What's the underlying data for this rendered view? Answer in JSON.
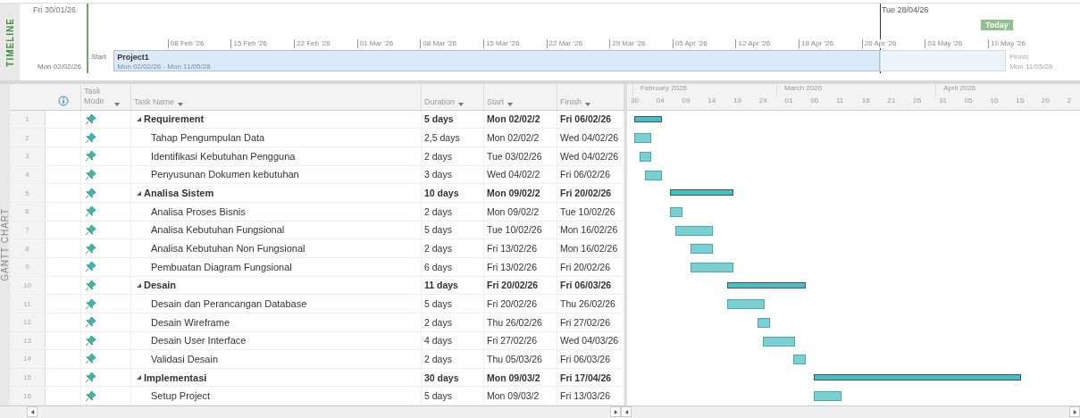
{
  "timeline": {
    "side_label": "TIMELINE",
    "left_date": "Fri 30/01/26",
    "today_date": "Tue 28/04/26",
    "today_badge": "Today",
    "ticks": [
      "08 Feb '26",
      "15 Feb '26",
      "22 Feb '26",
      "01 Mar '26",
      "08 Mar '26",
      "15 Mar '26",
      "22 Mar '26",
      "29 Mar '26",
      "05 Apr '26",
      "12 Apr '26",
      "19 Apr '26",
      "26 Apr '26",
      "03 May '26",
      "10 May '26"
    ],
    "start_label": "Start",
    "start_date": "Mon 02/02/26",
    "project_name": "Project1",
    "project_range": "Mon 02/02/26 - Mon 11/05/26",
    "finish_label": "Finish",
    "finish_date": "Mon 11/05/26"
  },
  "gantt": {
    "side_label": "GANTT CHART",
    "columns": [
      {
        "label": "Task Mode"
      },
      {
        "label": "Task Name"
      },
      {
        "label": "Duration"
      },
      {
        "label": "Start"
      },
      {
        "label": "Finish"
      }
    ],
    "months": [
      "February 2026",
      "March 2026",
      "April 2026"
    ],
    "days": [
      "30",
      "04",
      "09",
      "14",
      "19",
      "24",
      "01",
      "06",
      "11",
      "16",
      "21",
      "26",
      "31",
      "05",
      "10",
      "15",
      "20",
      "2"
    ],
    "tasks": [
      {
        "num": "1",
        "name": "Requirement",
        "duration": "5 days",
        "start": "Mon 02/02/2",
        "finish": "Fri 06/02/26",
        "expanded": true,
        "children": [
          {
            "num": "2",
            "name": "Tahap Pengumpulan Data",
            "duration": "2,5 days",
            "start": "Mon 02/02/2",
            "finish": "Wed 04/02/26"
          },
          {
            "num": "3",
            "name": "Identifikasi Kebutuhan Pengguna",
            "duration": "2 days",
            "start": "Tue 03/02/26",
            "finish": "Wed 04/02/26"
          },
          {
            "num": "4",
            "name": "Penyusunan Dokumen kebutuhan",
            "duration": "3 days",
            "start": "Wed 04/02/2",
            "finish": "Fri 06/02/26"
          }
        ]
      },
      {
        "num": "5",
        "name": "Analisa Sistem",
        "duration": "10 days",
        "start": "Mon 09/02/2",
        "finish": "Fri 20/02/26",
        "expanded": true,
        "children": [
          {
            "num": "6",
            "name": "Analisa Proses Bisnis",
            "duration": "2 days",
            "start": "Mon 09/02/2",
            "finish": "Tue 10/02/26"
          },
          {
            "num": "7",
            "name": "Analisa Kebutuhan Fungsional",
            "duration": "5 days",
            "start": "Tue 10/02/26",
            "finish": "Mon 16/02/26"
          },
          {
            "num": "8",
            "name": "Analisa Kebutuhan Non Fungsional",
            "duration": "2 days",
            "start": "Fri 13/02/26",
            "finish": "Mon 16/02/26"
          },
          {
            "num": "9",
            "name": "Pembuatan Diagram Fungsional",
            "duration": "6 days",
            "start": "Fri 13/02/26",
            "finish": "Fri 20/02/26"
          }
        ]
      },
      {
        "num": "10",
        "name": "Desain",
        "duration": "11 days",
        "start": "Fri 20/02/26",
        "finish": "Fri 06/03/26",
        "expanded": true,
        "children": [
          {
            "num": "11",
            "name": "Desain dan Perancangan Database",
            "duration": "5 days",
            "start": "Fri 20/02/26",
            "finish": "Thu 26/02/26"
          },
          {
            "num": "12",
            "name": "Desain Wireframe",
            "duration": "2 days",
            "start": "Thu 26/02/26",
            "finish": "Fri 27/02/26"
          },
          {
            "num": "13",
            "name": "Desain User  Interface",
            "duration": "4 days",
            "start": "Fri 27/02/26",
            "finish": "Wed 04/03/26"
          },
          {
            "num": "14",
            "name": "Validasi Desain",
            "duration": "2 days",
            "start": "Thu 05/03/26",
            "finish": "Fri 06/03/26"
          }
        ]
      },
      {
        "num": "15",
        "name": "Implementasi",
        "duration": "30 days",
        "start": "Mon 09/03/2",
        "finish": "Fri 17/04/26",
        "expanded": true,
        "children": [
          {
            "num": "16",
            "name": "Setup Project",
            "duration": "5 days",
            "start": "Mon 09/03/2",
            "finish": "Fri 13/03/26"
          }
        ]
      }
    ]
  }
}
